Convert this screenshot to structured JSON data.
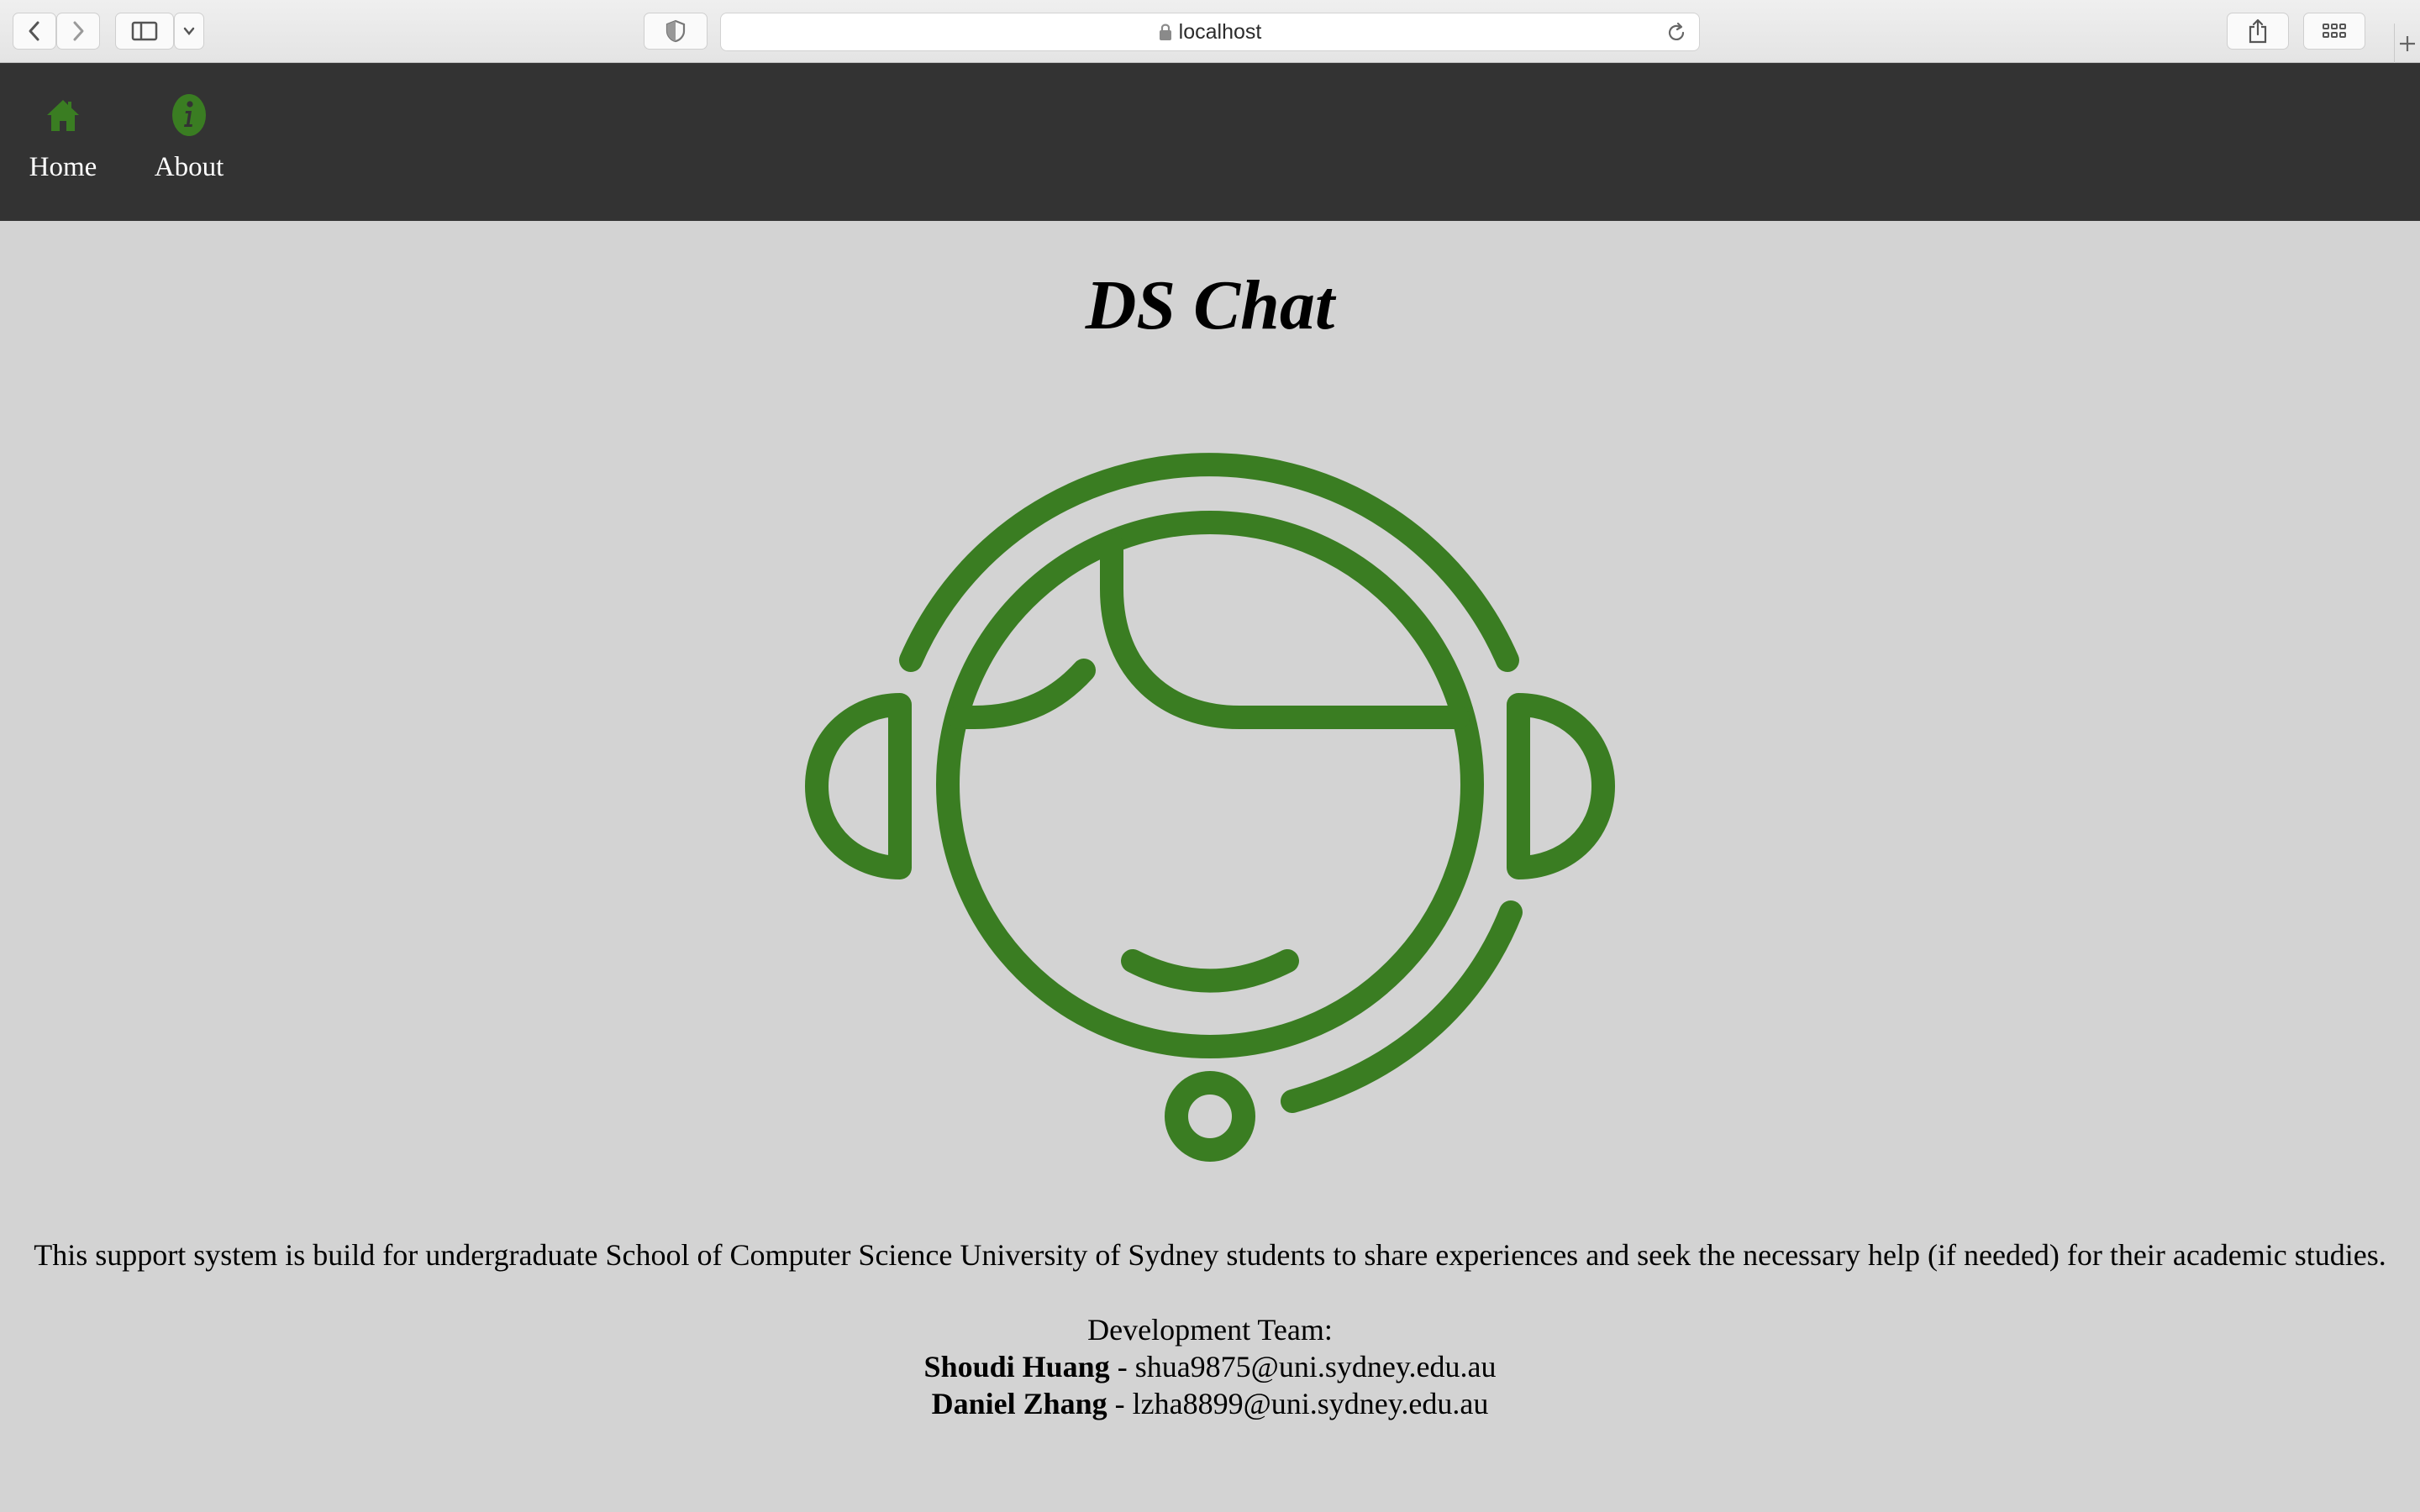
{
  "browser": {
    "url": "localhost",
    "icons": {
      "back": "chevron-left-icon",
      "forward": "chevron-right-icon",
      "sidebar": "sidebar-icon",
      "sidebar_menu": "chevron-down-icon",
      "privacy": "shield-icon",
      "lock": "lock-icon",
      "reload": "reload-icon",
      "share": "share-icon",
      "tabs": "grid-icon",
      "new_tab": "plus-icon"
    }
  },
  "nav": {
    "items": [
      {
        "label": "Home",
        "icon": "home-icon"
      },
      {
        "label": "About",
        "icon": "info-icon"
      }
    ]
  },
  "colors": {
    "accent": "#3a7d22",
    "nav_bg": "#333333",
    "page_bg": "#d3d3d3"
  },
  "main": {
    "title": "DS Chat",
    "logo": "support-agent-headset-icon",
    "description": "This support system is build for undergraduate School of Computer Science University of Sydney students to share experiences and seek the necessary help (if needed) for their academic studies.",
    "team": {
      "heading": "Development Team:",
      "members": [
        {
          "name": "Shoudi Huang",
          "separator": " - ",
          "email": "shua9875@uni.sydney.edu.au"
        },
        {
          "name": "Daniel Zhang",
          "separator": " - ",
          "email": "lzha8899@uni.sydney.edu.au"
        }
      ]
    }
  }
}
